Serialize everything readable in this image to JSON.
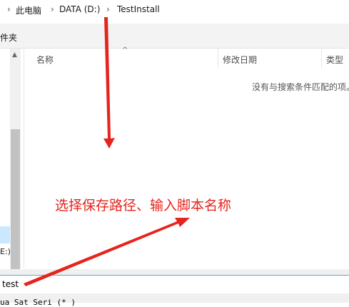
{
  "breadcrumb": {
    "this_pc": "此电脑",
    "drive": "DATA (D:)",
    "folder": "TestInstall"
  },
  "toolbar": {
    "new_folder": "件夹"
  },
  "nav": {
    "drive_label": "E:)"
  },
  "columns": {
    "name": "名称",
    "modified": "修改日期",
    "type": "类型"
  },
  "file_list": {
    "empty_message": "没有与搜索条件匹配的项。"
  },
  "filename": {
    "value": "test"
  },
  "file_type": {
    "text": "ua Sat Seri  (* )"
  },
  "annotation": {
    "text": "选择保存路径、输入脚本名称",
    "color": "#e6231c"
  },
  "icons": [
    "chevron-right-icon",
    "sort-up-icon",
    "scroll-up-icon"
  ]
}
